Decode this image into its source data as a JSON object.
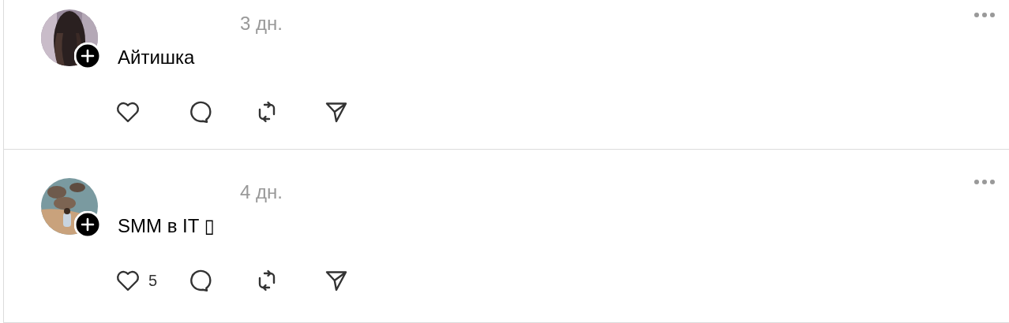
{
  "posts": [
    {
      "time": "3 дн.",
      "text": "Айтишка"
    },
    {
      "time": "4 дн.",
      "text": "SMM в IT ▯",
      "likes": "5"
    }
  ]
}
